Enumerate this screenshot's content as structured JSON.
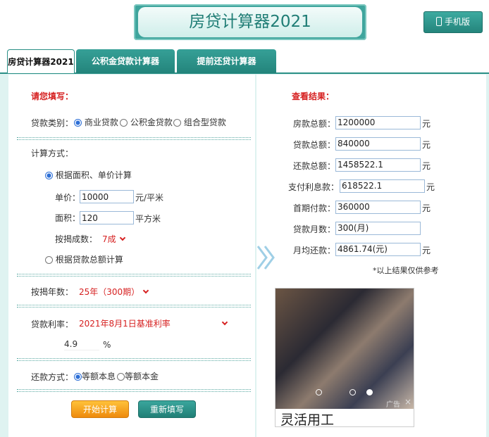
{
  "header": {
    "title": "房贷计算器2021",
    "mobile_label": "手机版"
  },
  "tabs": [
    {
      "label": "房贷计算器2021",
      "active": true
    },
    {
      "label": "公积金贷款计算器",
      "active": false
    },
    {
      "label": "提前还贷计算器",
      "active": false
    }
  ],
  "form": {
    "heading": "请您填写：",
    "loan_type_label": "贷款类别：",
    "loan_types": [
      "商业贷款",
      "公积金贷款",
      "组合型贷款"
    ],
    "loan_type_selected": "商业贷款",
    "calc_method_label": "计算方式：",
    "method_area": "根据面积、单价计算",
    "method_total": "根据贷款总额计算",
    "method_selected": "根据面积、单价计算",
    "unit_price_label": "单价：",
    "unit_price_value": "10000",
    "unit_price_unit": "元/平米",
    "area_label": "面积：",
    "area_value": "120",
    "area_unit": "平方米",
    "ratio_label": "按揭成数：",
    "ratio_value": "7成",
    "years_label": "按揭年数：",
    "years_value": "25年（300期）",
    "rate_label": "贷款利率：",
    "rate_value": "2021年8月1日基准利率",
    "rate_number": "4.9",
    "rate_unit": "%",
    "repay_label": "还款方式：",
    "repay_options": [
      "等额本息",
      "等额本金"
    ],
    "repay_selected": "等额本息",
    "start_button": "开始计算",
    "reset_button": "重新填写"
  },
  "results": {
    "heading": "查看结果：",
    "rows": [
      {
        "label": "房款总额：",
        "value": "1200000",
        "unit": "元"
      },
      {
        "label": "贷款总额：",
        "value": "840000",
        "unit": "元"
      },
      {
        "label": "还款总额：",
        "value": "1458522.1",
        "unit": "元"
      },
      {
        "label": "支付利息款：",
        "value": "618522.1",
        "unit": "元"
      },
      {
        "label": "首期付款：",
        "value": "360000",
        "unit": "元"
      },
      {
        "label": "贷款月数：",
        "value": "300(月)",
        "unit": ""
      },
      {
        "label": "月均还款：",
        "value": "4861.74(元)",
        "unit": "元"
      }
    ],
    "note": "*以上结果仅供参考"
  },
  "ad": {
    "caption": "灵活用工",
    "badge": "广告",
    "close": "×"
  },
  "colors": {
    "accent": "#2a8f86",
    "red": "#d62020",
    "panel_bg": "#dff3f1"
  }
}
